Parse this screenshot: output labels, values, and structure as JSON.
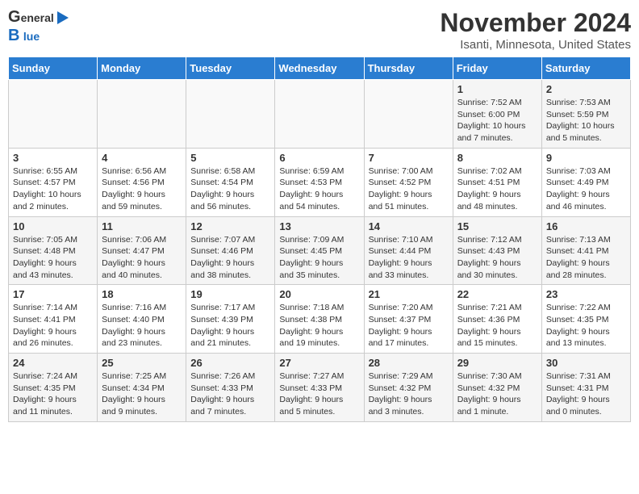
{
  "header": {
    "logo_line1": "General",
    "logo_line2": "Blue",
    "month_title": "November 2024",
    "location": "Isanti, Minnesota, United States"
  },
  "weekdays": [
    "Sunday",
    "Monday",
    "Tuesday",
    "Wednesday",
    "Thursday",
    "Friday",
    "Saturday"
  ],
  "weeks": [
    [
      {
        "day": "",
        "info": ""
      },
      {
        "day": "",
        "info": ""
      },
      {
        "day": "",
        "info": ""
      },
      {
        "day": "",
        "info": ""
      },
      {
        "day": "",
        "info": ""
      },
      {
        "day": "1",
        "info": "Sunrise: 7:52 AM\nSunset: 6:00 PM\nDaylight: 10 hours and 7 minutes."
      },
      {
        "day": "2",
        "info": "Sunrise: 7:53 AM\nSunset: 5:59 PM\nDaylight: 10 hours and 5 minutes."
      }
    ],
    [
      {
        "day": "3",
        "info": "Sunrise: 6:55 AM\nSunset: 4:57 PM\nDaylight: 10 hours and 2 minutes."
      },
      {
        "day": "4",
        "info": "Sunrise: 6:56 AM\nSunset: 4:56 PM\nDaylight: 9 hours and 59 minutes."
      },
      {
        "day": "5",
        "info": "Sunrise: 6:58 AM\nSunset: 4:54 PM\nDaylight: 9 hours and 56 minutes."
      },
      {
        "day": "6",
        "info": "Sunrise: 6:59 AM\nSunset: 4:53 PM\nDaylight: 9 hours and 54 minutes."
      },
      {
        "day": "7",
        "info": "Sunrise: 7:00 AM\nSunset: 4:52 PM\nDaylight: 9 hours and 51 minutes."
      },
      {
        "day": "8",
        "info": "Sunrise: 7:02 AM\nSunset: 4:51 PM\nDaylight: 9 hours and 48 minutes."
      },
      {
        "day": "9",
        "info": "Sunrise: 7:03 AM\nSunset: 4:49 PM\nDaylight: 9 hours and 46 minutes."
      }
    ],
    [
      {
        "day": "10",
        "info": "Sunrise: 7:05 AM\nSunset: 4:48 PM\nDaylight: 9 hours and 43 minutes."
      },
      {
        "day": "11",
        "info": "Sunrise: 7:06 AM\nSunset: 4:47 PM\nDaylight: 9 hours and 40 minutes."
      },
      {
        "day": "12",
        "info": "Sunrise: 7:07 AM\nSunset: 4:46 PM\nDaylight: 9 hours and 38 minutes."
      },
      {
        "day": "13",
        "info": "Sunrise: 7:09 AM\nSunset: 4:45 PM\nDaylight: 9 hours and 35 minutes."
      },
      {
        "day": "14",
        "info": "Sunrise: 7:10 AM\nSunset: 4:44 PM\nDaylight: 9 hours and 33 minutes."
      },
      {
        "day": "15",
        "info": "Sunrise: 7:12 AM\nSunset: 4:43 PM\nDaylight: 9 hours and 30 minutes."
      },
      {
        "day": "16",
        "info": "Sunrise: 7:13 AM\nSunset: 4:41 PM\nDaylight: 9 hours and 28 minutes."
      }
    ],
    [
      {
        "day": "17",
        "info": "Sunrise: 7:14 AM\nSunset: 4:41 PM\nDaylight: 9 hours and 26 minutes."
      },
      {
        "day": "18",
        "info": "Sunrise: 7:16 AM\nSunset: 4:40 PM\nDaylight: 9 hours and 23 minutes."
      },
      {
        "day": "19",
        "info": "Sunrise: 7:17 AM\nSunset: 4:39 PM\nDaylight: 9 hours and 21 minutes."
      },
      {
        "day": "20",
        "info": "Sunrise: 7:18 AM\nSunset: 4:38 PM\nDaylight: 9 hours and 19 minutes."
      },
      {
        "day": "21",
        "info": "Sunrise: 7:20 AM\nSunset: 4:37 PM\nDaylight: 9 hours and 17 minutes."
      },
      {
        "day": "22",
        "info": "Sunrise: 7:21 AM\nSunset: 4:36 PM\nDaylight: 9 hours and 15 minutes."
      },
      {
        "day": "23",
        "info": "Sunrise: 7:22 AM\nSunset: 4:35 PM\nDaylight: 9 hours and 13 minutes."
      }
    ],
    [
      {
        "day": "24",
        "info": "Sunrise: 7:24 AM\nSunset: 4:35 PM\nDaylight: 9 hours and 11 minutes."
      },
      {
        "day": "25",
        "info": "Sunrise: 7:25 AM\nSunset: 4:34 PM\nDaylight: 9 hours and 9 minutes."
      },
      {
        "day": "26",
        "info": "Sunrise: 7:26 AM\nSunset: 4:33 PM\nDaylight: 9 hours and 7 minutes."
      },
      {
        "day": "27",
        "info": "Sunrise: 7:27 AM\nSunset: 4:33 PM\nDaylight: 9 hours and 5 minutes."
      },
      {
        "day": "28",
        "info": "Sunrise: 7:29 AM\nSunset: 4:32 PM\nDaylight: 9 hours and 3 minutes."
      },
      {
        "day": "29",
        "info": "Sunrise: 7:30 AM\nSunset: 4:32 PM\nDaylight: 9 hours and 1 minute."
      },
      {
        "day": "30",
        "info": "Sunrise: 7:31 AM\nSunset: 4:31 PM\nDaylight: 9 hours and 0 minutes."
      }
    ]
  ]
}
